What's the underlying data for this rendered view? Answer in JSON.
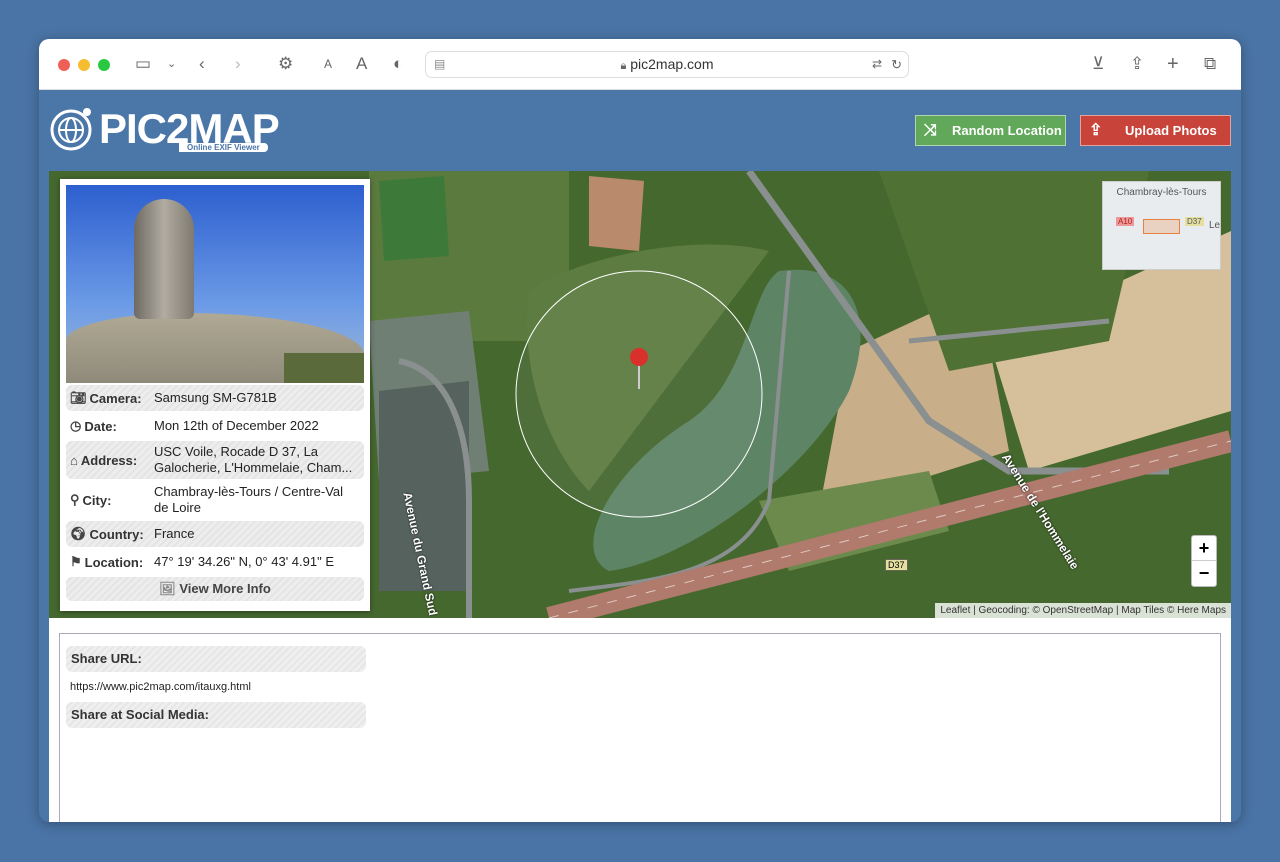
{
  "browser": {
    "url": "pic2map.com",
    "colors": {
      "close": "#ee5f57",
      "minimize": "#f5bd2f",
      "maximize": "#28c840"
    }
  },
  "header": {
    "logo_text": "PIC2MAP",
    "logo_subtitle": "Online EXIF Viewer",
    "random_label": "Random Location",
    "upload_label": "Upload Photos",
    "colors": {
      "header": "#4a76a8",
      "random": "#62a85a",
      "upload": "#c8443b"
    }
  },
  "card": {
    "rows": [
      {
        "label": "Camera:",
        "value": "Samsung SM-G781B",
        "icon": "camera-icon"
      },
      {
        "label": "Date:",
        "value": "Mon 12th of December 2022",
        "icon": "clock-icon"
      },
      {
        "label": "Address:",
        "value": "USC Voile, Rocade D 37, La Galocherie, L'Hommelaie, Cham...",
        "icon": "home-icon"
      },
      {
        "label": "City:",
        "value": "Chambray-lès-Tours / Centre-Val de Loire",
        "icon": "user-location-icon"
      },
      {
        "label": "Country:",
        "value": "France",
        "icon": "globe-icon"
      },
      {
        "label": "Location:",
        "value": "47° 19' 34.26\" N, 0° 43' 4.91\" E",
        "icon": "map-pin-icon"
      }
    ],
    "more_label": "View More Info"
  },
  "map": {
    "labels": {
      "road1": "Avenue du Grand Sud",
      "road2": "Avenue de l'Hommelaie",
      "d37": "D37"
    },
    "minimap": {
      "city": "Chambray-lès-Tours",
      "a10": "A10",
      "d37": "D37",
      "partial": "Le"
    },
    "zoom_in": "+",
    "zoom_out": "−",
    "attribution": "Leaflet | Geocoding: © OpenStreetMap | Map Tiles © Here Maps"
  },
  "share": {
    "url_label": "Share URL:",
    "url": "https://www.pic2map.com/itauxg.html",
    "social_label": "Share at Social Media:"
  }
}
